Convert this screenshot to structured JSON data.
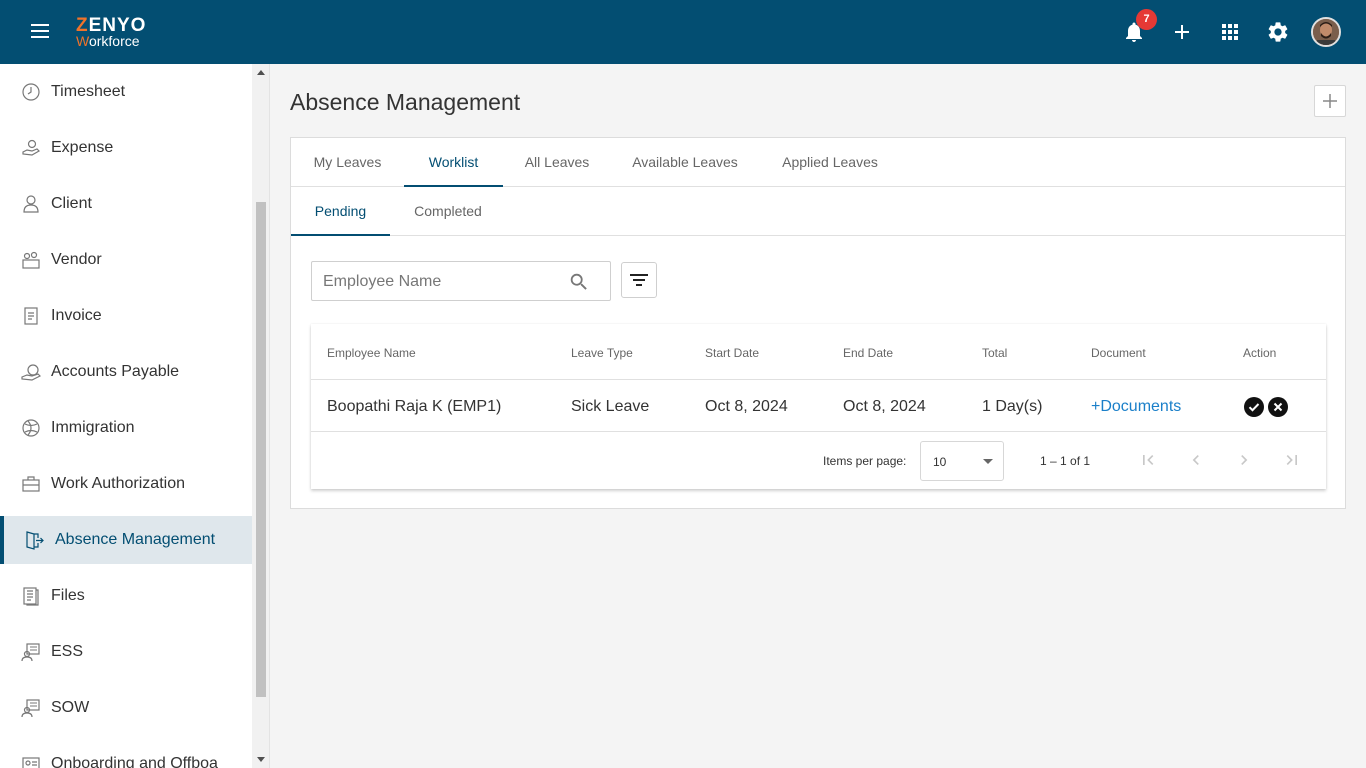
{
  "app": {
    "logo_top_rest": "ENYO",
    "logo_top_first": "Z",
    "logo_bottom_first": "W",
    "logo_bottom_rest": "orkforce",
    "notification_count": "7"
  },
  "sidebar": {
    "items": [
      {
        "label": "Timesheet",
        "icon": "clock-icon"
      },
      {
        "label": "Expense",
        "icon": "expense-icon"
      },
      {
        "label": "Client",
        "icon": "person-icon"
      },
      {
        "label": "Vendor",
        "icon": "vendor-icon"
      },
      {
        "label": "Invoice",
        "icon": "invoice-icon"
      },
      {
        "label": "Accounts Payable",
        "icon": "accounts-payable-icon"
      },
      {
        "label": "Immigration",
        "icon": "globe-icon"
      },
      {
        "label": "Work Authorization",
        "icon": "briefcase-icon"
      },
      {
        "label": "Absence Management",
        "icon": "door-exit-icon",
        "active": true
      },
      {
        "label": "Files",
        "icon": "files-icon"
      },
      {
        "label": "ESS",
        "icon": "ess-icon"
      },
      {
        "label": "SOW",
        "icon": "sow-icon"
      },
      {
        "label": "Onboarding and Offboa",
        "icon": "onboarding-icon"
      }
    ]
  },
  "main": {
    "title": "Absence Management",
    "tabs": [
      {
        "label": "My Leaves"
      },
      {
        "label": "Worklist",
        "active": true
      },
      {
        "label": "All Leaves"
      },
      {
        "label": "Available Leaves"
      },
      {
        "label": "Applied Leaves"
      }
    ],
    "subtabs": [
      {
        "label": "Pending",
        "active": true
      },
      {
        "label": "Completed"
      }
    ],
    "search": {
      "placeholder": "Employee Name",
      "value": ""
    },
    "table": {
      "columns": [
        "Employee Name",
        "Leave Type",
        "Start Date",
        "End Date",
        "Total",
        "Document",
        "Action"
      ],
      "rows": [
        {
          "employee_name": "Boopathi Raja K (EMP1)",
          "leave_type": "Sick Leave",
          "start_date": "Oct 8, 2024",
          "end_date": "Oct 8, 2024",
          "total": "1 Day(s)",
          "document": "+Documents"
        }
      ]
    },
    "paginator": {
      "items_per_page_label": "Items per page:",
      "items_per_page": "10",
      "range": "1 – 1 of 1"
    }
  },
  "colors": {
    "brand": "#034e72",
    "accent": "#f0732a",
    "badge": "#e53935",
    "link": "#1a7fc9"
  }
}
